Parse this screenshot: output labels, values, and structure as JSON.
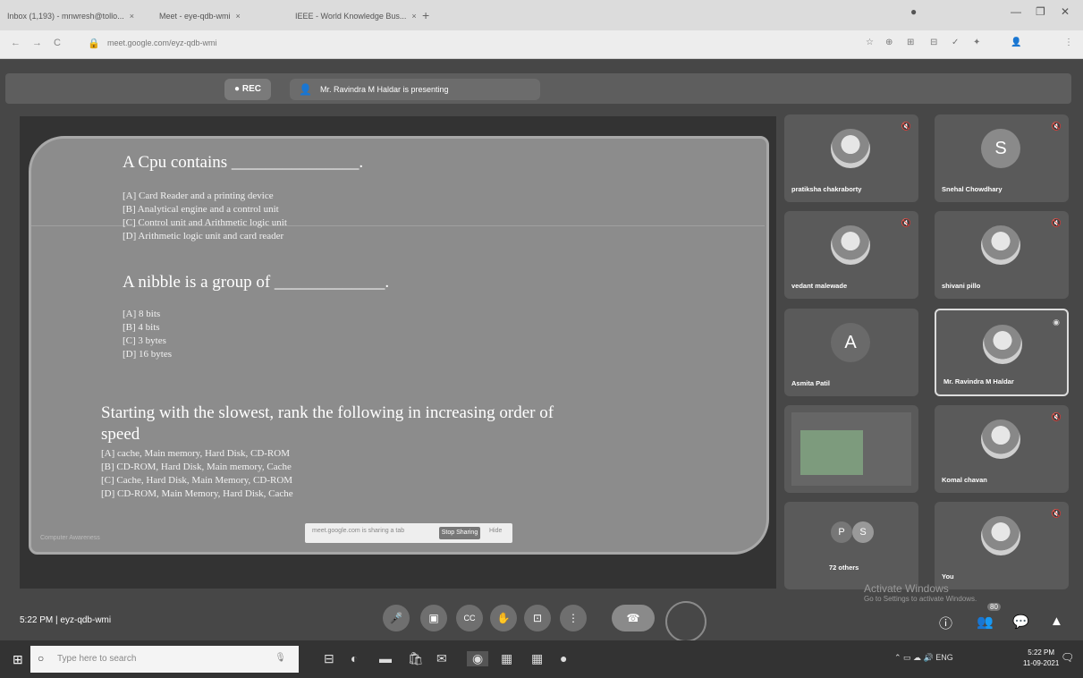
{
  "browser": {
    "tabs": [
      {
        "label": "Inbox (1,193) - mnwresh@tollo...",
        "close": "×"
      },
      {
        "label": "Meet - eye-qdb-wmi",
        "close": "×"
      },
      {
        "label": "IEEE - World Knowledge Bus...",
        "close": "×"
      }
    ],
    "new_tab": "+",
    "window_controls": [
      "—",
      "❐",
      "✕"
    ],
    "nav": [
      "←",
      "→",
      "C"
    ],
    "url": "meet.google.com/eyz-qdb-wmi",
    "extensions": [
      "☆",
      "⊕",
      "⊞",
      "⊟",
      "✓",
      "✦",
      "👤",
      "⋮"
    ]
  },
  "meet": {
    "rec_label": "● REC",
    "presenting_text": "Mr. Ravindra M Haldar is presenting",
    "presenting_icon": "👤",
    "meeting_time": "5:22 PM",
    "meeting_code": "eyz-qdb-wmi",
    "activate_title": "Activate Windows",
    "activate_sub": "Go to Settings to activate Windows."
  },
  "slide": {
    "q1": "A Cpu contains _______________.",
    "q1_options": [
      "[A] Card Reader and a printing device",
      "[B] Analytical engine and a control unit",
      "[C] Control unit and Arithmetic logic unit",
      "[D] Arithmetic logic unit and card reader"
    ],
    "q2": "A nibble is a group of _____________.",
    "q2_options": [
      "[A] 8 bits",
      "[B] 4 bits",
      "[C] 3 bytes",
      "[D] 16 bytes"
    ],
    "q3_line1": "Starting with the slowest, rank the following in increasing order of",
    "q3_line2": "speed",
    "q3_options": [
      "[A] cache, Main memory, Hard Disk, CD-ROM",
      "[B] CD-ROM, Hard Disk, Main memory, Cache",
      "[C] Cache, Hard Disk, Main Memory, CD-ROM",
      "[D] CD-ROM, Main Memory, Hard Disk, Cache"
    ],
    "footer_left": "Computer Awareness",
    "sharebar_text": "meet.google.com is sharing a tab",
    "stop_sharing": "Stop Sharing",
    "hide": "Hide"
  },
  "participants": [
    {
      "name": "pratiksha chakraborty",
      "kind": "photo",
      "mic": "🔇"
    },
    {
      "name": "Snehal Chowdhary",
      "kind": "letter",
      "letter": "S",
      "mic": "🔇"
    },
    {
      "name": "vedant malewade",
      "kind": "photo",
      "mic": "🔇"
    },
    {
      "name": "shivani pillo",
      "kind": "photo",
      "mic": "🔇"
    },
    {
      "name": "Asmita Patil",
      "kind": "letter",
      "letter": "A",
      "mic": ""
    },
    {
      "name": "Mr. Ravindra M Haldar",
      "kind": "photo",
      "mic": "◉"
    },
    {
      "name": "",
      "kind": "screen",
      "mic": ""
    },
    {
      "name": "Komal chavan",
      "kind": "photo",
      "mic": "🔇"
    },
    {
      "name": "72 others",
      "kind": "others",
      "letters": [
        "P",
        "S"
      ],
      "mic": ""
    },
    {
      "name": "You",
      "kind": "photo",
      "mic": "🔇"
    }
  ],
  "controls": {
    "mic": "🎤",
    "cc": "CC",
    "hand": "✋",
    "present": "⊡",
    "more": "⋮",
    "end": "☎",
    "info": "ⓘ",
    "people": "👥",
    "chat": "💬",
    "activities": "▲",
    "people_count": "80"
  },
  "taskbar": {
    "start": "⊞",
    "search_placeholder": "Type here to search",
    "search_icon": "○",
    "mic_icon": "🎙",
    "icons": [
      "⊟",
      "◐",
      "▬",
      "🛍",
      "✉",
      "◉",
      "▦",
      "▦",
      "●"
    ],
    "tray": "⌃ ▭ ☁ 🔊 ENG",
    "time": "5:22 PM",
    "date": "11-09-2021",
    "notif": "🗨"
  }
}
